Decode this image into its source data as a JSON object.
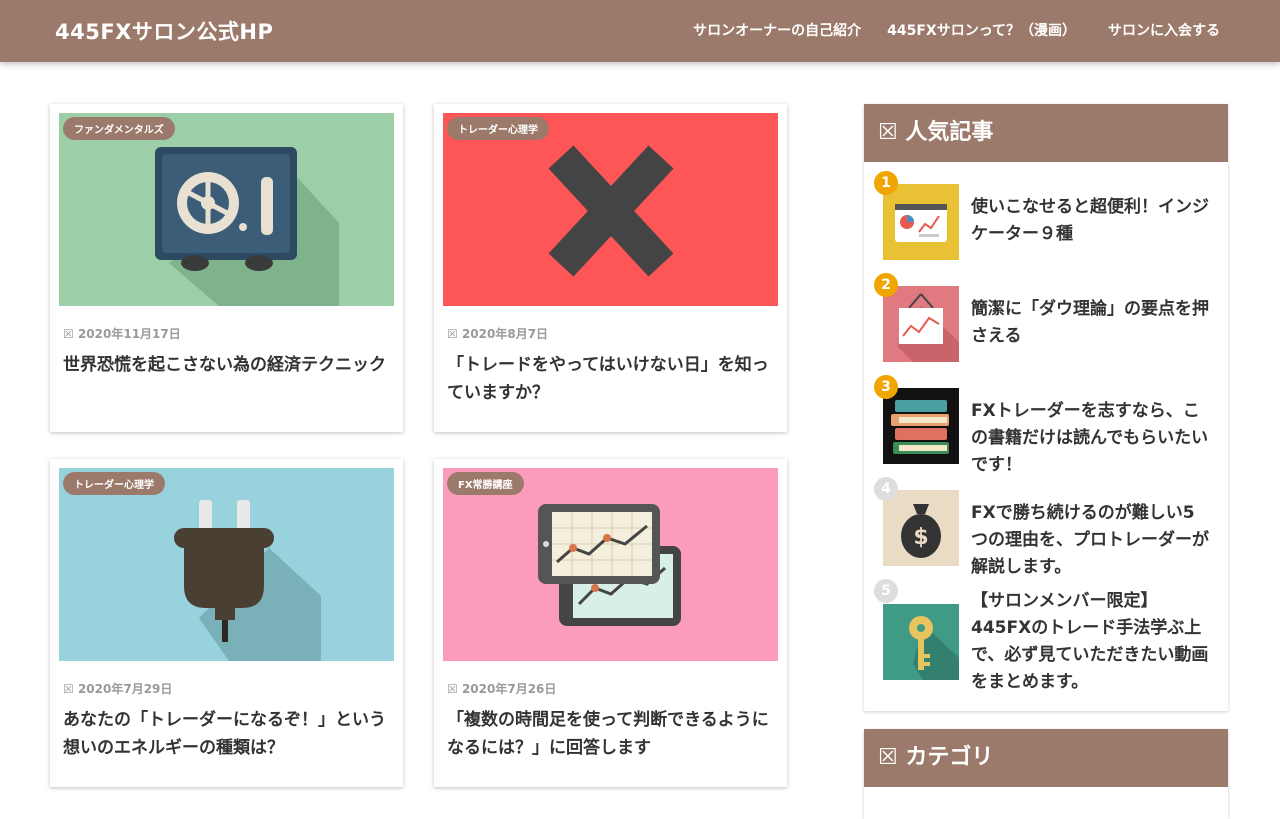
{
  "header": {
    "site_title": "445FXサロン公式HP",
    "nav": [
      "サロンオーナーの自己紹介",
      "445FXサロンって？（漫画）",
      "サロンに入会する"
    ]
  },
  "posts": [
    {
      "category": "ファンダメンタルズ",
      "date": "2020年11月17日",
      "title": "世界恐慌を起こさない為の経済テクニック"
    },
    {
      "category": "トレーダー心理学",
      "date": "2020年8月7日",
      "title": "「トレードをやってはいけない日」を知っていますか？"
    },
    {
      "category": "トレーダー心理学",
      "date": "2020年7月29日",
      "title": "あなたの「トレーダーになるぞ！」という想いのエネルギーの種類は？"
    },
    {
      "category": "FX常勝講座",
      "date": "2020年7月26日",
      "title": "「複数の時間足を使って判断できるようになるには？」に回答します"
    }
  ],
  "sidebar": {
    "popular": {
      "heading": "人気記事",
      "items": [
        {
          "rank": "1",
          "title": "使いこなせると超便利！インジケーター９種"
        },
        {
          "rank": "2",
          "title": "簡潔に「ダウ理論」の要点を押さえる"
        },
        {
          "rank": "3",
          "title": "FXトレーダーを志すなら、この書籍だけは読んでもらいたいです！"
        },
        {
          "rank": "4",
          "title": "FXで勝ち続けるのが難しい5つの理由を、プロトレーダーが解説します。"
        },
        {
          "rank": "5",
          "title": "【サロンメンバー限定】445FXのトレード手法学ぶ上で、必ず見ていただきたい動画をまとめます。"
        }
      ]
    },
    "categories": {
      "heading": "カテゴリ"
    }
  },
  "icons": {
    "date": "calendar-icon",
    "widget_heading": "widget-heading-icon",
    "broken_glyph": "☒",
    "dollar": "$"
  },
  "colors": {
    "brand": "#9c7a6b",
    "rank_gold": "#f0a500",
    "rank_gray": "#dddddd"
  }
}
